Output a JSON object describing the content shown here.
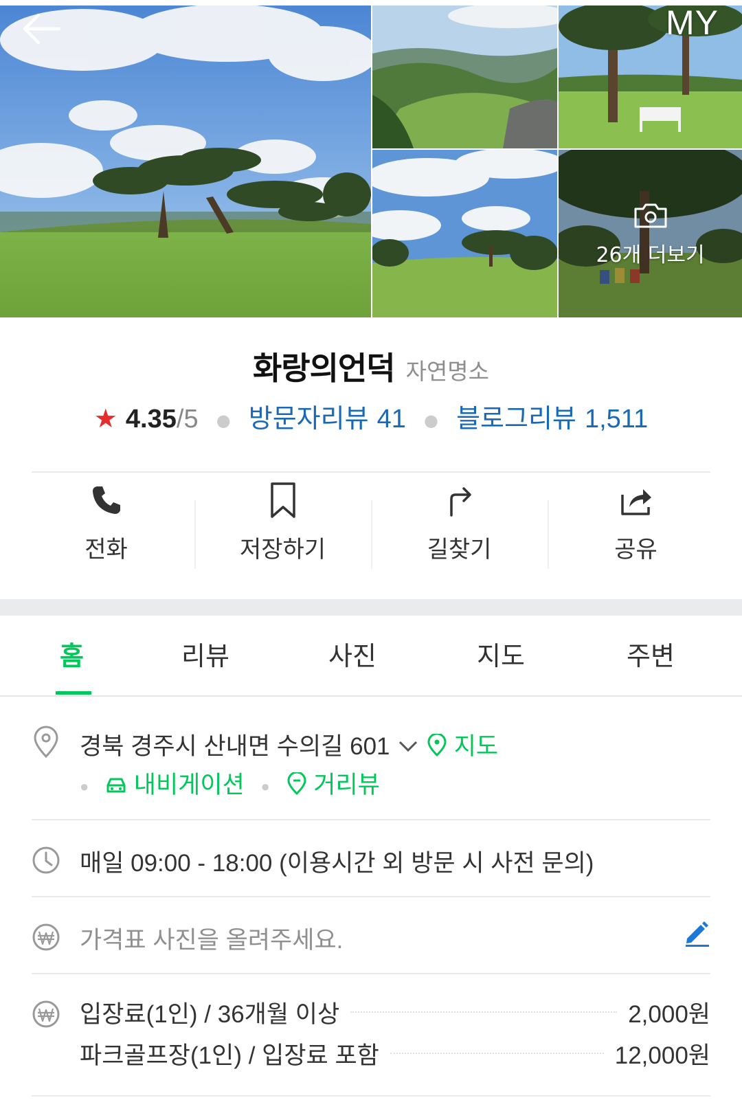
{
  "header": {
    "my_label": "MY"
  },
  "gallery": {
    "more_label": "26개 더보기"
  },
  "place": {
    "name": "화랑의언덕",
    "category": "자연명소",
    "rating": "4.35",
    "rating_max": "/5",
    "visitor_review_label": "방문자리뷰",
    "visitor_review_count": "41",
    "blog_review_label": "블로그리뷰",
    "blog_review_count": "1,511"
  },
  "actions": [
    {
      "label": "전화",
      "icon": "phone-icon"
    },
    {
      "label": "저장하기",
      "icon": "bookmark-icon"
    },
    {
      "label": "길찾기",
      "icon": "directions-icon"
    },
    {
      "label": "공유",
      "icon": "share-icon"
    }
  ],
  "tabs": [
    {
      "label": "홈",
      "active": true
    },
    {
      "label": "리뷰"
    },
    {
      "label": "사진"
    },
    {
      "label": "지도"
    },
    {
      "label": "주변"
    }
  ],
  "info": {
    "address": "경북 경주시 산내면 수의길 601",
    "map_link": "지도",
    "navigation_link": "내비게이션",
    "street_view_link": "거리뷰",
    "hours": "매일 09:00 - 18:00 (이용시간 외 방문 시 사전 문의)",
    "price_photo_prompt": "가격표 사진을 올려주세요.",
    "prices": [
      {
        "name": "입장료(1인) / 36개월 이상",
        "value": "2,000원"
      },
      {
        "name": "파크골프장(1인) / 입장료 포함",
        "value": "12,000원"
      }
    ]
  },
  "colors": {
    "accent_green": "#03c75a",
    "link_blue": "#1b69b6",
    "star_red": "#e62d2d"
  }
}
